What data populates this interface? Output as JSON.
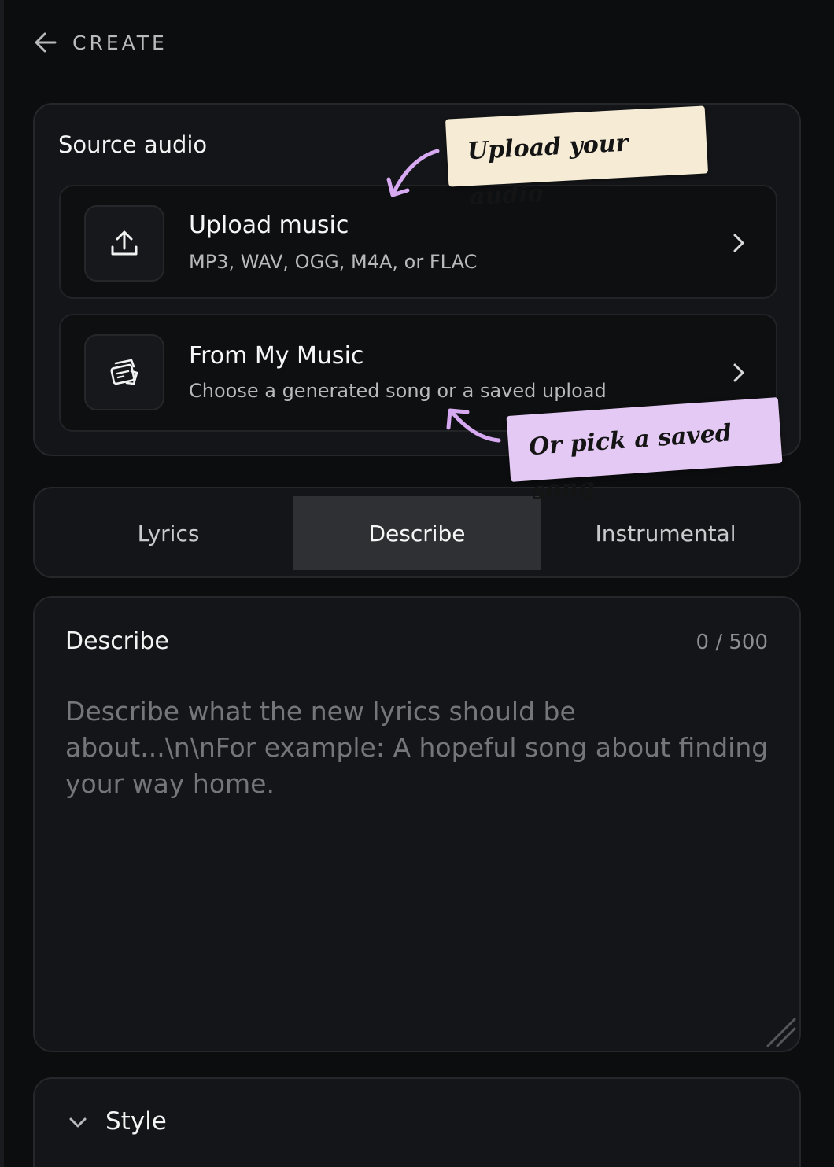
{
  "header": {
    "back_icon": "arrow-left-icon",
    "title": "CREATE"
  },
  "source_audio": {
    "title": "Source audio",
    "options": [
      {
        "icon": "upload-icon",
        "title": "Upload music",
        "subtitle": "MP3, WAV, OGG, M4A, or FLAC"
      },
      {
        "icon": "music-library-icon",
        "title": "From My Music",
        "subtitle": "Choose a generated song or a saved upload"
      }
    ],
    "notes": {
      "upload": "Upload your audio",
      "saved": "Or pick a saved song"
    }
  },
  "mode_tabs": {
    "items": [
      "Lyrics",
      "Describe",
      "Instrumental"
    ],
    "selected": "Describe"
  },
  "describe": {
    "title": "Describe",
    "count": "0 / 500",
    "value": "",
    "placeholder": "Describe what the new lyrics should be about...\\n\\nFor example: A hopeful song about finding your way home."
  },
  "style_section": {
    "title": "Style",
    "icon": "chevron-down-icon"
  },
  "colors": {
    "background": "#0c0d0f",
    "card": "#141518",
    "note_upload": "#f6ecd6",
    "note_saved": "#e3c9f3",
    "arrow": "#d6a9f1",
    "tab_active": "#2f3034"
  }
}
